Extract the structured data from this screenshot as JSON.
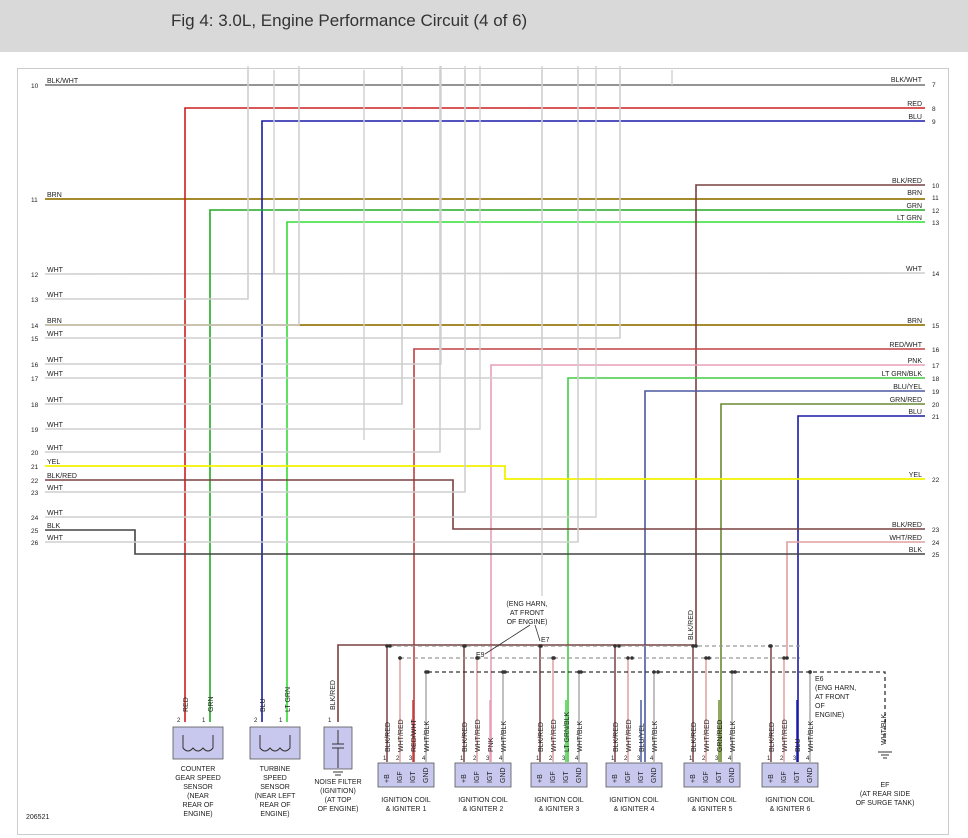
{
  "title": "Fig 4: 3.0L, Engine Performance Circuit (4 of 6)",
  "figure_number": "206521",
  "colors": {
    "BLK/WHT": "#707070",
    "RED": "#cc2020",
    "BLU": "#1a1aaa",
    "BRN": "#9a7a10",
    "GRN": "#22aa22",
    "LT GRN": "#33dd33",
    "WHT": "#cfcfcf",
    "YEL": "#f2f200",
    "BLK/RED": "#7a4040",
    "RED/WHT": "#c04040",
    "PNK": "#e8a0b8",
    "LT GRN/BLK": "#44cc44",
    "BLU/YEL": "#4a5aa0",
    "GRN/RED": "#6a8a30",
    "WHT/RED": "#e0a0a0",
    "BLK": "#444444",
    "WHT/BLK": "#aaaaaa"
  },
  "left_wires": [
    {
      "n": "10",
      "label": "BLK/WHT"
    },
    {
      "n": "11",
      "label": "BRN"
    },
    {
      "n": "12",
      "label": "WHT"
    },
    {
      "n": "13",
      "label": "WHT"
    },
    {
      "n": "14",
      "label": "BRN"
    },
    {
      "n": "15",
      "label": "WHT"
    },
    {
      "n": "16",
      "label": "WHT"
    },
    {
      "n": "17",
      "label": "WHT"
    },
    {
      "n": "18",
      "label": "WHT"
    },
    {
      "n": "19",
      "label": "WHT"
    },
    {
      "n": "20",
      "label": "WHT"
    },
    {
      "n": "21",
      "label": "YEL"
    },
    {
      "n": "22",
      "label": "BLK/RED"
    },
    {
      "n": "23",
      "label": "WHT"
    },
    {
      "n": "24",
      "label": "WHT"
    },
    {
      "n": "25",
      "label": "BLK"
    },
    {
      "n": "26",
      "label": "WHT"
    }
  ],
  "right_wires": [
    {
      "n": "7",
      "label": "BLK/WHT"
    },
    {
      "n": "8",
      "label": "RED"
    },
    {
      "n": "9",
      "label": "BLU"
    },
    {
      "n": "10",
      "label": "BLK/RED"
    },
    {
      "n": "11",
      "label": "BRN"
    },
    {
      "n": "12",
      "label": "GRN"
    },
    {
      "n": "13",
      "label": "LT GRN"
    },
    {
      "n": "14",
      "label": "WHT"
    },
    {
      "n": "15",
      "label": "BRN"
    },
    {
      "n": "16",
      "label": "RED/WHT"
    },
    {
      "n": "17",
      "label": "PNK"
    },
    {
      "n": "18",
      "label": "LT GRN/BLK"
    },
    {
      "n": "19",
      "label": "BLU/YEL"
    },
    {
      "n": "20",
      "label": "GRN/RED"
    },
    {
      "n": "21",
      "label": "BLU"
    },
    {
      "n": "22",
      "label": "YEL"
    },
    {
      "n": "23",
      "label": "BLK/RED"
    },
    {
      "n": "24",
      "label": "WHT/RED"
    },
    {
      "n": "25",
      "label": "BLK"
    }
  ],
  "sensors": [
    {
      "id": "counter",
      "pins": [
        {
          "n": "2",
          "wire": "RED"
        },
        {
          "n": "1",
          "wire": "GRN"
        }
      ],
      "caption": [
        "COUNTER",
        "GEAR SPEED",
        "SENSOR",
        "(NEAR",
        "REAR OF",
        "ENGINE)"
      ]
    },
    {
      "id": "turbine",
      "pins": [
        {
          "n": "2",
          "wire": "BLU"
        },
        {
          "n": "1",
          "wire": "LT GRN"
        }
      ],
      "caption": [
        "TURBINE",
        "SPEED",
        "SENSOR",
        "(NEAR LEFT",
        "REAR OF",
        "ENGINE)"
      ]
    }
  ],
  "noise_filter": {
    "pin": "1",
    "wire": "BLK/RED",
    "caption": [
      "NOISE FILTER",
      "(IGNITION)",
      "(AT TOP",
      "OF ENGINE)"
    ]
  },
  "coil_pin_labels": [
    "+B",
    "IGF",
    "IGT",
    "GND"
  ],
  "coils": [
    {
      "wires": [
        "BLK/RED",
        "WHT/RED",
        "RED/WHT",
        "WHT/BLK"
      ],
      "caption": [
        "IGNITION COIL",
        "& IGNITER 1"
      ]
    },
    {
      "wires": [
        "BLK/RED",
        "WHT/RED",
        "PNK",
        "WHT/BLK"
      ],
      "caption": [
        "IGNITION COIL",
        "& IGNITER 2"
      ]
    },
    {
      "wires": [
        "BLK/RED",
        "WHT/RED",
        "LT GRN/BLK",
        "WHT/BLK"
      ],
      "caption": [
        "IGNITION COIL",
        "& IGNITER 3"
      ]
    },
    {
      "wires": [
        "BLK/RED",
        "WHT/RED",
        "BLU/YEL",
        "WHT/BLK"
      ],
      "caption": [
        "IGNITION COIL",
        "& IGNITER 4"
      ]
    },
    {
      "wires": [
        "BLK/RED",
        "WHT/RED",
        "GRN/RED",
        "WHT/BLK"
      ],
      "caption": [
        "IGNITION COIL",
        "& IGNITER 5"
      ]
    },
    {
      "wires": [
        "BLK/RED",
        "WHT/RED",
        "BLU",
        "WHT/BLK"
      ],
      "caption": [
        "IGNITION COIL",
        "& IGNITER 6"
      ]
    }
  ],
  "splices": {
    "e9": "E9",
    "e7": "E7",
    "e7_note": [
      "(ENG HARN,",
      "AT FRONT",
      "OF ENGINE)"
    ],
    "e6": "E6",
    "e6_note": [
      "(ENG HARN,",
      "AT FRONT",
      "OF",
      "ENGINE)"
    ],
    "e6_wire": "WHT/BLK",
    "coil5_feed_label": "BLK/RED"
  },
  "ground": {
    "label": "EF",
    "caption": [
      "(AT REAR SIDE",
      "OF SURGE TANK)"
    ]
  }
}
